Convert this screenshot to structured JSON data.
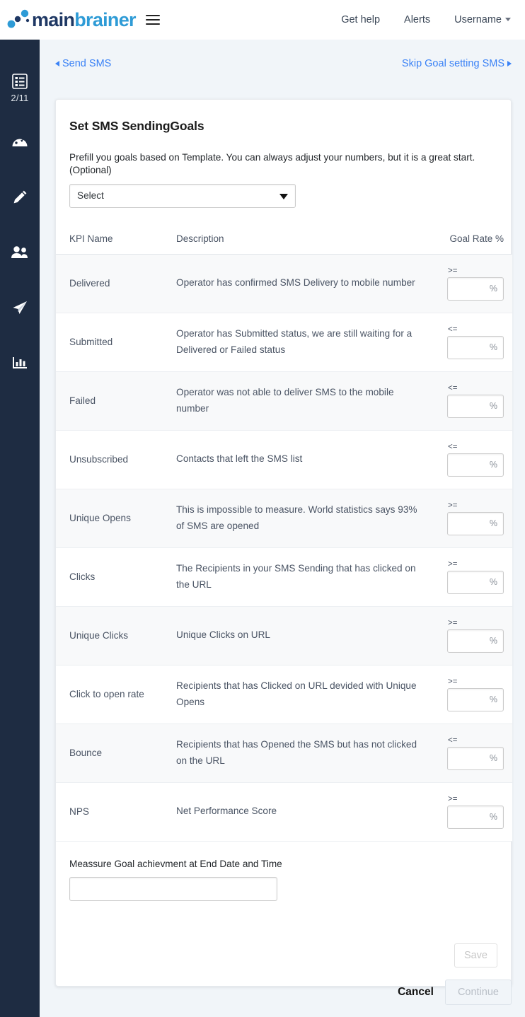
{
  "header": {
    "logo_main": "main",
    "logo_brainer": "brainer",
    "menu_icon": "hamburger-icon",
    "nav": [
      {
        "label": "Get help"
      },
      {
        "label": "Alerts"
      },
      {
        "label": "Username"
      }
    ]
  },
  "sidebar": {
    "step_icon": "list-icon",
    "step_counter": "2/11",
    "items": [
      {
        "icon": "dashboard-gauge-icon"
      },
      {
        "icon": "pencil-icon"
      },
      {
        "icon": "people-icon"
      },
      {
        "icon": "paper-plane-icon"
      },
      {
        "icon": "bar-chart-icon"
      }
    ]
  },
  "breadcrumb": {
    "back_label": "Send SMS",
    "skip_label": "Skip Goal setting SMS"
  },
  "card": {
    "title": "Set SMS SendingGoals",
    "prefill_text": "Prefill you goals based on Template. You can always adjust your numbers, but it is a great start.(Optional)",
    "template_select": {
      "value": "Select",
      "options": [
        "Select"
      ]
    },
    "table": {
      "columns": [
        "KPI Name",
        "Description",
        "Goal Rate %"
      ],
      "rows": [
        {
          "kpi": "Delivered",
          "description": "Operator has confirmed SMS Delivery to mobile number",
          "operator": ">=",
          "value": "",
          "unit": "%"
        },
        {
          "kpi": "Submitted",
          "description": "Operator has Submitted status, we are still waiting for a Delivered or Failed status",
          "operator": "<=",
          "value": "",
          "unit": "%"
        },
        {
          "kpi": "Failed",
          "description": "Operator was not able to deliver SMS to the mobile number",
          "operator": "<=",
          "value": "",
          "unit": "%"
        },
        {
          "kpi": "Unsubscribed",
          "description": "Contacts that left the SMS list",
          "operator": "<=",
          "value": "",
          "unit": "%"
        },
        {
          "kpi": "Unique Opens",
          "description": "This is impossible to measure. World statistics says 93% of SMS are opened",
          "operator": ">=",
          "value": "",
          "unit": "%"
        },
        {
          "kpi": "Clicks",
          "description": "The Recipients in your SMS Sending that has clicked on the URL",
          "operator": ">=",
          "value": "",
          "unit": "%"
        },
        {
          "kpi": "Unique Clicks",
          "description": "Unique Clicks on URL",
          "operator": ">=",
          "value": "",
          "unit": "%"
        },
        {
          "kpi": "Click to open rate",
          "description": "Recipients that has Clicked on URL devided with Unique Opens",
          "operator": ">=",
          "value": "",
          "unit": "%"
        },
        {
          "kpi": "Bounce",
          "description": "Recipients that has Opened the SMS but has not clicked on the URL",
          "operator": "<=",
          "value": "",
          "unit": "%"
        },
        {
          "kpi": "NPS",
          "description": "Net Performance Score",
          "operator": ">=",
          "value": "",
          "unit": "%"
        }
      ]
    },
    "measure": {
      "label": "Meassure Goal achievment at End Date and Time",
      "value": "",
      "placeholder": ""
    },
    "save_label": "Save"
  },
  "footer": {
    "cancel_label": "Cancel",
    "continue_label": "Continue"
  },
  "colors": {
    "sidebar_bg": "#1e2c42",
    "page_bg": "#f1f5f9",
    "link_blue": "#3b82f6",
    "logo_dark": "#1f3864",
    "logo_light": "#2e9bd6",
    "row_alt": "#f8f9fa"
  }
}
